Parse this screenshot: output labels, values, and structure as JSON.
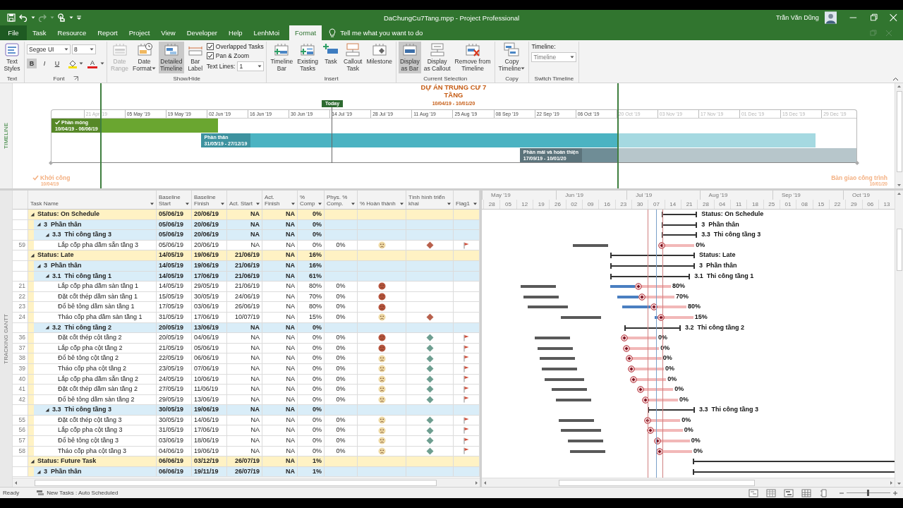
{
  "title_bar": {
    "document_title": "DaChungCu7Tang.mpp - Project Professional",
    "user_name": "Trần Văn Dũng"
  },
  "menu_tabs": [
    {
      "label": "File",
      "kind": "file",
      "selected": false
    },
    {
      "label": "Task",
      "kind": "tab",
      "selected": false
    },
    {
      "label": "Resource",
      "kind": "tab",
      "selected": false
    },
    {
      "label": "Report",
      "kind": "tab",
      "selected": false
    },
    {
      "label": "Project",
      "kind": "tab",
      "selected": false
    },
    {
      "label": "View",
      "kind": "tab",
      "selected": false
    },
    {
      "label": "Developer",
      "kind": "tab",
      "selected": false
    },
    {
      "label": "Help",
      "kind": "tab",
      "selected": false
    },
    {
      "label": "LenhMoi",
      "kind": "tab",
      "selected": false
    },
    {
      "label": "Format",
      "kind": "tab",
      "selected": true
    }
  ],
  "tell_me": "Tell me what you want to do",
  "ribbon": {
    "groups": [
      {
        "label": "Text",
        "items": [
          {
            "kind": "large",
            "label": "Text\nStyles",
            "dropdown": false,
            "selected": false,
            "disabled": false
          }
        ]
      },
      {
        "label": "Font",
        "launcher": true,
        "items": [
          {
            "kind": "font",
            "font": "Segoe UI",
            "size": "8",
            "styles": [
              {
                "label": "B",
                "selected": true
              },
              {
                "label": "I",
                "selected": false
              },
              {
                "label": "U",
                "selected": false
              }
            ],
            "font_color": "A"
          }
        ]
      },
      {
        "label": "Show/Hide",
        "items": [
          {
            "kind": "large",
            "label": "Date\nRange",
            "dropdown": false,
            "selected": false,
            "disabled": true
          },
          {
            "kind": "large",
            "label": "Date\nFormat",
            "dropdown": true,
            "selected": false,
            "disabled": false
          },
          {
            "kind": "large",
            "label": "Detailed\nTimeline",
            "dropdown": false,
            "selected": true,
            "disabled": false
          },
          {
            "kind": "large",
            "label": "Bar\nLabel",
            "dropdown": false,
            "selected": false,
            "disabled": false
          },
          {
            "kind": "options",
            "checks": [
              {
                "label": "Overlapped Tasks",
                "checked": true
              },
              {
                "label": "Pan & Zoom",
                "checked": true
              }
            ],
            "text_lines": {
              "label": "Text Lines:",
              "value": "1"
            }
          }
        ]
      },
      {
        "label": "Insert",
        "items": [
          {
            "kind": "large",
            "label": "Timeline\nBar",
            "dropdown": false,
            "selected": false,
            "disabled": false
          },
          {
            "kind": "large",
            "label": "Existing\nTasks",
            "dropdown": false,
            "selected": false,
            "disabled": false
          },
          {
            "kind": "large",
            "label": "Task",
            "dropdown": false,
            "selected": false,
            "disabled": false
          },
          {
            "kind": "large",
            "label": "Callout\nTask",
            "dropdown": false,
            "selected": false,
            "disabled": false
          },
          {
            "kind": "large",
            "label": "Milestone",
            "dropdown": false,
            "selected": false,
            "disabled": false
          }
        ]
      },
      {
        "label": "Current Selection",
        "items": [
          {
            "kind": "large",
            "label": "Display\nas Bar",
            "dropdown": false,
            "selected": true,
            "disabled": false
          },
          {
            "kind": "large",
            "label": "Display\nas Callout",
            "dropdown": false,
            "selected": false,
            "disabled": false
          },
          {
            "kind": "large",
            "label": "Remove from\nTimeline",
            "dropdown": false,
            "selected": false,
            "disabled": false
          }
        ]
      },
      {
        "label": "Copy",
        "items": [
          {
            "kind": "large",
            "label": "Copy\nTimeline",
            "dropdown": true,
            "selected": false,
            "disabled": false
          }
        ]
      },
      {
        "label": "Switch Timeline",
        "items": [
          {
            "kind": "switch",
            "label": "Timeline:",
            "value": "Timeline"
          }
        ]
      }
    ]
  },
  "timeline": {
    "side_label": "TIMELINE",
    "title": "DỰ ÁN TRUNG CƯ 7 TẦNG",
    "dates": "10/04/19 - 10/01/20",
    "today": "Today",
    "ticks": [
      {
        "label": "21 Apr '19",
        "dimmed": true
      },
      {
        "label": "05 May '19",
        "dimmed": false
      },
      {
        "label": "19 May '19",
        "dimmed": false
      },
      {
        "label": "02 Jun '19",
        "dimmed": false
      },
      {
        "label": "16 Jun '19",
        "dimmed": false
      },
      {
        "label": "30 Jun '19",
        "dimmed": false
      },
      {
        "label": "14 Jul '19",
        "dimmed": false
      },
      {
        "label": "28 Jul '19",
        "dimmed": false
      },
      {
        "label": "11 Aug '19",
        "dimmed": false
      },
      {
        "label": "25 Aug '19",
        "dimmed": false
      },
      {
        "label": "08 Sep '19",
        "dimmed": false
      },
      {
        "label": "22 Sep '19",
        "dimmed": false
      },
      {
        "label": "06 Oct '19",
        "dimmed": false
      },
      {
        "label": "20 Oct '19",
        "dimmed": true
      },
      {
        "label": "03 Nov '19",
        "dimmed": true
      },
      {
        "label": "17 Nov '19",
        "dimmed": true
      },
      {
        "label": "01 Dec '19",
        "dimmed": true
      },
      {
        "label": "15 Dec '19",
        "dimmed": true
      },
      {
        "label": "29 Dec '19",
        "dimmed": true
      }
    ],
    "bars": [
      {
        "name": "Phần móng",
        "dates": "10/04/19 - 06/06/19",
        "color": "#6aa630",
        "completed": true
      },
      {
        "name": "Phần thân",
        "dates": "31/05/19 - 27/12/19",
        "color": "#4bb3c2",
        "completed": false
      },
      {
        "name": "Phần mái và hoàn thiện",
        "dates": "17/09/19 - 10/01/20",
        "color": "#6f8d96",
        "completed": false
      }
    ],
    "start_milestone": {
      "label": "Khởi công",
      "date": "10/04/19",
      "completed": true
    },
    "finish_milestone": {
      "label": "Bàn giao công trình",
      "date": "10/01/20"
    }
  },
  "view_label": "TRACKING GANTT",
  "table": {
    "columns": [
      {
        "label": "Task Name"
      },
      {
        "label": "Baseline\nStart"
      },
      {
        "label": "Baseline\nFinish"
      },
      {
        "label": "Act. Start"
      },
      {
        "label": "Act.\nFinish"
      },
      {
        "label": "%\nComp"
      },
      {
        "label": "Phys. %\nComp."
      },
      {
        "label": "% Hoàn thành"
      },
      {
        "label": "Tình hình triển\nkhai"
      },
      {
        "label": "Flag1"
      }
    ],
    "rows": [
      {
        "kind": "group",
        "name": "Status: On Schedule",
        "expanded": true,
        "baseline_start": "05/06/19",
        "baseline_finish": "20/06/19",
        "act_start": "NA",
        "act_finish": "NA",
        "pct_comp": "0%",
        "gantt_label": "Status: On Schedule",
        "children": [
          {
            "kind": "summary",
            "name": "3  Phần thân",
            "expanded": true,
            "baseline_start": "05/06/19",
            "baseline_finish": "20/06/19",
            "act_start": "NA",
            "act_finish": "NA",
            "pct_comp": "0%",
            "gantt_label": "3  Phần thân",
            "children": [
              {
                "kind": "summary",
                "name": "3.3  Thi công tầng 3",
                "expanded": true,
                "baseline_start": "05/06/19",
                "baseline_finish": "20/06/19",
                "act_start": "NA",
                "act_finish": "NA",
                "pct_comp": "0%",
                "gantt_label": "3.3  Thi công tầng 3",
                "children": [
                  {
                    "kind": "task",
                    "id": "59",
                    "name": "Lắp cốp pha dầm sẵn tầng 3",
                    "baseline_start": "05/06/19",
                    "baseline_finish": "20/06/19",
                    "act_start": "NA",
                    "act_finish": "NA",
                    "pct_comp": "0%",
                    "phys_comp": "0%",
                    "completion": {
                      "color": "#eed9a4"
                    },
                    "status": {
                      "color": "#b8604c"
                    },
                    "flag": true,
                    "gantt_label": "0%"
                  }
                ]
              }
            ]
          }
        ]
      },
      {
        "kind": "group",
        "name": "Status: Late",
        "expanded": true,
        "baseline_start": "14/05/19",
        "baseline_finish": "19/06/19",
        "act_start": "21/06/19",
        "act_finish": "NA",
        "pct_comp": "16%",
        "gantt_label": "Status: Late",
        "children": [
          {
            "kind": "summary",
            "name": "3  Phần thân",
            "expanded": true,
            "baseline_start": "14/05/19",
            "baseline_finish": "19/06/19",
            "act_start": "21/06/19",
            "act_finish": "NA",
            "pct_comp": "16%",
            "gantt_label": "3  Phần thân",
            "children": [
              {
                "kind": "summary",
                "name": "3.1  Thi công tầng 1",
                "expanded": true,
                "baseline_start": "14/05/19",
                "baseline_finish": "17/06/19",
                "act_start": "21/06/19",
                "act_finish": "NA",
                "pct_comp": "61%",
                "gantt_label": "3.1  Thi công tầng 1",
                "children": [
                  {
                    "kind": "task",
                    "id": "21",
                    "name": "Lắp cốp pha dầm sàn tầng 1",
                    "baseline_start": "14/05/19",
                    "baseline_finish": "29/05/19",
                    "act_start": "21/06/19",
                    "act_finish": "NA",
                    "pct_comp": "80%",
                    "phys_comp": "0%",
                    "completion": {
                      "color": "#b5533c"
                    },
                    "flag": false,
                    "gantt_label": "80%"
                  },
                  {
                    "kind": "task",
                    "id": "22",
                    "name": "Đặt cốt thép dầm sàn tầng 1",
                    "baseline_start": "15/05/19",
                    "baseline_finish": "30/05/19",
                    "act_start": "24/06/19",
                    "act_finish": "NA",
                    "pct_comp": "70%",
                    "phys_comp": "0%",
                    "completion": {
                      "color": "#b5533c"
                    },
                    "flag": false,
                    "gantt_label": "70%"
                  },
                  {
                    "kind": "task",
                    "id": "23",
                    "name": "Đổ bê tông dầm sàn tầng 1",
                    "baseline_start": "17/05/19",
                    "baseline_finish": "03/06/19",
                    "act_start": "26/06/19",
                    "act_finish": "NA",
                    "pct_comp": "80%",
                    "phys_comp": "0%",
                    "completion": {
                      "color": "#b5533c"
                    },
                    "flag": false,
                    "gantt_label": "80%"
                  },
                  {
                    "kind": "task",
                    "id": "24",
                    "name": "Tháo cốp pha dầm sàn tầng 1",
                    "baseline_start": "31/05/19",
                    "baseline_finish": "17/06/19",
                    "act_start": "10/07/19",
                    "act_finish": "NA",
                    "pct_comp": "15%",
                    "phys_comp": "0%",
                    "completion": {
                      "color": "#eed9a4"
                    },
                    "status": {
                      "color": "#b8604c"
                    },
                    "flag": false,
                    "gantt_label": "15%"
                  }
                ]
              },
              {
                "kind": "summary",
                "name": "3.2  Thi công tầng 2",
                "expanded": true,
                "baseline_start": "20/05/19",
                "baseline_finish": "13/06/19",
                "act_start": "NA",
                "act_finish": "NA",
                "pct_comp": "0%",
                "gantt_label": "3.2  Thi công tầng 2",
                "children": [
                  {
                    "kind": "task",
                    "id": "36",
                    "name": "Đặt cốt thép cột tầng 2",
                    "baseline_start": "20/05/19",
                    "baseline_finish": "04/06/19",
                    "act_start": "NA",
                    "act_finish": "NA",
                    "pct_comp": "0%",
                    "phys_comp": "0%",
                    "completion": {
                      "color": "#b5533c"
                    },
                    "status": {
                      "color": "#6e9e90"
                    },
                    "flag": true,
                    "gantt_label": "0%"
                  },
                  {
                    "kind": "task",
                    "id": "37",
                    "name": "Lắp cốp pha cột tầng 2",
                    "baseline_start": "21/05/19",
                    "baseline_finish": "05/06/19",
                    "act_start": "NA",
                    "act_finish": "NA",
                    "pct_comp": "0%",
                    "phys_comp": "0%",
                    "completion": {
                      "color": "#b5533c"
                    },
                    "status": {
                      "color": "#6e9e90"
                    },
                    "flag": true,
                    "gantt_label": "0%"
                  },
                  {
                    "kind": "task",
                    "id": "38",
                    "name": "Đổ bê tông cột tầng 2",
                    "baseline_start": "22/05/19",
                    "baseline_finish": "06/06/19",
                    "act_start": "NA",
                    "act_finish": "NA",
                    "pct_comp": "0%",
                    "phys_comp": "0%",
                    "completion": {
                      "color": "#eed9a4"
                    },
                    "status": {
                      "color": "#6e9e90"
                    },
                    "flag": true,
                    "gantt_label": "0%"
                  },
                  {
                    "kind": "task",
                    "id": "39",
                    "name": "Tháo cốp pha cột tầng 2",
                    "baseline_start": "23/05/19",
                    "baseline_finish": "07/06/19",
                    "act_start": "NA",
                    "act_finish": "NA",
                    "pct_comp": "0%",
                    "phys_comp": "0%",
                    "completion": {
                      "color": "#eed9a4"
                    },
                    "status": {
                      "color": "#6e9e90"
                    },
                    "flag": true,
                    "gantt_label": "0%"
                  },
                  {
                    "kind": "task",
                    "id": "40",
                    "name": "Lắp cốp pha dầm sẵn tầng 2",
                    "baseline_start": "24/05/19",
                    "baseline_finish": "10/06/19",
                    "act_start": "NA",
                    "act_finish": "NA",
                    "pct_comp": "0%",
                    "phys_comp": "0%",
                    "completion": {
                      "color": "#eed9a4"
                    },
                    "status": {
                      "color": "#6e9e90"
                    },
                    "flag": true,
                    "gantt_label": "0%"
                  },
                  {
                    "kind": "task",
                    "id": "41",
                    "name": "Đặt cốt thép dầm sàn tầng 2",
                    "baseline_start": "27/05/19",
                    "baseline_finish": "11/06/19",
                    "act_start": "NA",
                    "act_finish": "NA",
                    "pct_comp": "0%",
                    "phys_comp": "0%",
                    "completion": {
                      "color": "#eed9a4"
                    },
                    "status": {
                      "color": "#6e9e90"
                    },
                    "flag": true,
                    "gantt_label": "0%"
                  },
                  {
                    "kind": "task",
                    "id": "42",
                    "name": "Đổ bê tông dầm sàn tầng 2",
                    "baseline_start": "29/05/19",
                    "baseline_finish": "13/06/19",
                    "act_start": "NA",
                    "act_finish": "NA",
                    "pct_comp": "0%",
                    "phys_comp": "0%",
                    "completion": {
                      "color": "#eed9a4"
                    },
                    "status": {
                      "color": "#6e9e90"
                    },
                    "flag": true,
                    "gantt_label": "0%"
                  }
                ]
              },
              {
                "kind": "summary",
                "name": "3.3  Thi công tầng 3",
                "expanded": true,
                "baseline_start": "30/05/19",
                "baseline_finish": "19/06/19",
                "act_start": "NA",
                "act_finish": "NA",
                "pct_comp": "0%",
                "gantt_label": "3.3  Thi công tầng 3",
                "children": [
                  {
                    "kind": "task",
                    "id": "55",
                    "name": "Đặt cốt thép cột tầng 3",
                    "baseline_start": "30/05/19",
                    "baseline_finish": "14/06/19",
                    "act_start": "NA",
                    "act_finish": "NA",
                    "pct_comp": "0%",
                    "phys_comp": "0%",
                    "completion": {
                      "color": "#eed9a4"
                    },
                    "status": {
                      "color": "#6e9e90"
                    },
                    "flag": true,
                    "gantt_label": "0%"
                  },
                  {
                    "kind": "task",
                    "id": "56",
                    "name": "Lắp cốp pha cột tầng 3",
                    "baseline_start": "31/05/19",
                    "baseline_finish": "17/06/19",
                    "act_start": "NA",
                    "act_finish": "NA",
                    "pct_comp": "0%",
                    "phys_comp": "0%",
                    "completion": {
                      "color": "#eed9a4"
                    },
                    "status": {
                      "color": "#6e9e90"
                    },
                    "flag": true,
                    "gantt_label": "0%"
                  },
                  {
                    "kind": "task",
                    "id": "57",
                    "name": "Đổ bê tông cột tầng 3",
                    "baseline_start": "03/06/19",
                    "baseline_finish": "18/06/19",
                    "act_start": "NA",
                    "act_finish": "NA",
                    "pct_comp": "0%",
                    "phys_comp": "0%",
                    "completion": {
                      "color": "#eed9a4"
                    },
                    "status": {
                      "color": "#6e9e90"
                    },
                    "flag": true,
                    "gantt_label": "0%"
                  },
                  {
                    "kind": "task",
                    "id": "58",
                    "name": "Tháo cốp pha cột tầng 3",
                    "baseline_start": "04/06/19",
                    "baseline_finish": "19/06/19",
                    "act_start": "NA",
                    "act_finish": "NA",
                    "pct_comp": "0%",
                    "phys_comp": "0%",
                    "completion": {
                      "color": "#eed9a4"
                    },
                    "status": {
                      "color": "#6e9e90"
                    },
                    "flag": true,
                    "gantt_label": "0%"
                  }
                ]
              }
            ]
          }
        ]
      },
      {
        "kind": "group",
        "name": "Status: Future Task",
        "expanded": true,
        "baseline_start": "06/06/19",
        "baseline_finish": "03/12/19",
        "act_start": "26/07/19",
        "act_finish": "NA",
        "pct_comp": "1%",
        "children": [
          {
            "kind": "summary",
            "name": "3  Phần thân",
            "expanded": true,
            "baseline_start": "06/06/19",
            "baseline_finish": "19/11/19",
            "act_start": "26/07/19",
            "act_finish": "NA",
            "pct_comp": "1%"
          }
        ]
      }
    ]
  },
  "gantt": {
    "months": [
      "May '19",
      "Jun '19",
      "Jul '19",
      "Aug '19",
      "Sep '19",
      "Oct '19"
    ],
    "weeks": [
      "28",
      "05",
      "12",
      "19",
      "26",
      "02",
      "09",
      "16",
      "23",
      "30",
      "07",
      "14",
      "21",
      "28",
      "04",
      "11",
      "18",
      "25",
      "01",
      "08",
      "15",
      "22",
      "29",
      "06",
      "13"
    ]
  },
  "status_bar": {
    "ready": "Ready",
    "new_tasks": "New Tasks : Auto Scheduled",
    "zoom": {
      "level": 0.46
    }
  }
}
